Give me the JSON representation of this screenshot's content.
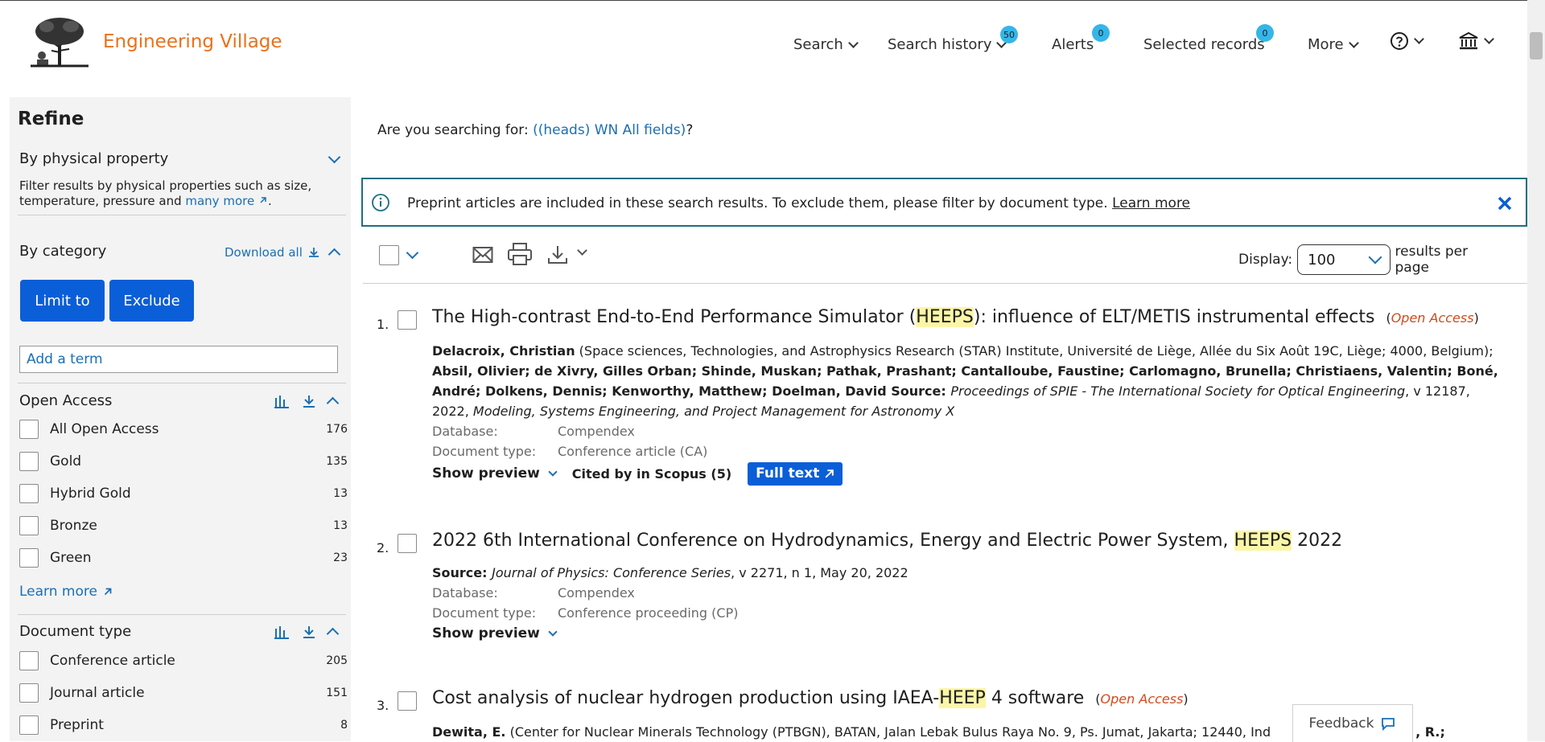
{
  "header": {
    "brand": "Engineering Village",
    "nav": {
      "search": "Search",
      "search_history": "Search history",
      "search_history_count": "50",
      "alerts": "Alerts",
      "alerts_count": "0",
      "selected_records": "Selected records",
      "selected_records_count": "0",
      "more": "More"
    }
  },
  "sidebar": {
    "title": "Refine",
    "physical": {
      "title": "By physical property",
      "desc": "Filter results by physical properties such as size, temperature, pressure and ",
      "link": "many more"
    },
    "category": {
      "title": "By category",
      "download_all": "Download all",
      "limit_to": "Limit to",
      "exclude": "Exclude",
      "term_placeholder": "Add a term"
    },
    "open_access": {
      "title": "Open Access",
      "items": [
        {
          "label": "All Open Access",
          "count": "176"
        },
        {
          "label": "Gold",
          "count": "135"
        },
        {
          "label": "Hybrid Gold",
          "count": "13"
        },
        {
          "label": "Bronze",
          "count": "13"
        },
        {
          "label": "Green",
          "count": "23"
        }
      ],
      "learn_more": "Learn more"
    },
    "doc_type": {
      "title": "Document type",
      "items": [
        {
          "label": "Conference article",
          "count": "205"
        },
        {
          "label": "Journal article",
          "count": "151"
        },
        {
          "label": "Preprint",
          "count": "8"
        }
      ]
    }
  },
  "main": {
    "suggest_prefix": "Are you searching for: ",
    "suggest_link": "((heads) WN All fields)",
    "suggest_suffix": "?",
    "banner_text": "Preprint articles are included in these search results. To exclude them, please filter by document type. ",
    "banner_link": "Learn more",
    "display_label": "Display:",
    "display_value": "100",
    "display_suffix": "results per page",
    "results": [
      {
        "num": "1.",
        "title_a": "The High-contrast End-to-End Performance Simulator (",
        "title_hl": "HEEPS",
        "title_b": "): influence of ELT/METIS instrumental effects",
        "open_access": "Open Access",
        "author_1": "Delacroix, Christian",
        "affil_1": " (Space sciences, Technologies, and Astrophysics Research (STAR) Institute, Université de Liège, Allée du Six Août 19C, Liège; 4000, Belgium); ",
        "authors_rest": "Absil, Olivier; de Xivry, Gilles Orban; Shinde, Muskan; Pathak, Prashant; Cantalloube, Faustine; Carlomagno, Brunella; Christiaens, Valentin; Boné, André; Dolkens, Dennis; Kenworthy, Matthew; Doelman, David",
        "source_label": " Source: ",
        "source_journal": "Proceedings of SPIE - The International Society for Optical Engineering",
        "source_mid": ", v 12187, 2022, ",
        "source_conf": "Modeling, Systems Engineering, and Project Management for Astronomy X",
        "database_label": "Database:",
        "database": "Compendex",
        "doctype_label": "Document type:",
        "doctype": "Conference article (CA)",
        "show_preview": "Show preview",
        "cited_by": "Cited by in Scopus (5)",
        "full_text": "Full text"
      },
      {
        "num": "2.",
        "title_a": "2022 6th International Conference on Hydrodynamics, Energy and Electric Power System, ",
        "title_hl": "HEEPS",
        "title_b": " 2022",
        "source_label": "Source: ",
        "source_journal": "Journal of Physics: Conference Series",
        "source_rest": ", v 2271, n 1, May 20, 2022",
        "database_label": "Database:",
        "database": "Compendex",
        "doctype_label": "Document type:",
        "doctype": "Conference proceeding (CP)",
        "show_preview": "Show preview"
      },
      {
        "num": "3.",
        "title_a": "Cost analysis of nuclear hydrogen production using IAEA-",
        "title_hl": "HEEP",
        "title_b": " 4 software",
        "open_access": "Open Access",
        "author_1": "Dewita, E.",
        "affil_1": " (Center for Nuclear Minerals Technology (PTBGN), BATAN, Jalan Lebak Bulus Raya No. 9, Ps. Jumat, Jakarta; 12440, Ind",
        "author_tail": ", R.;"
      }
    ],
    "feedback": "Feedback"
  }
}
